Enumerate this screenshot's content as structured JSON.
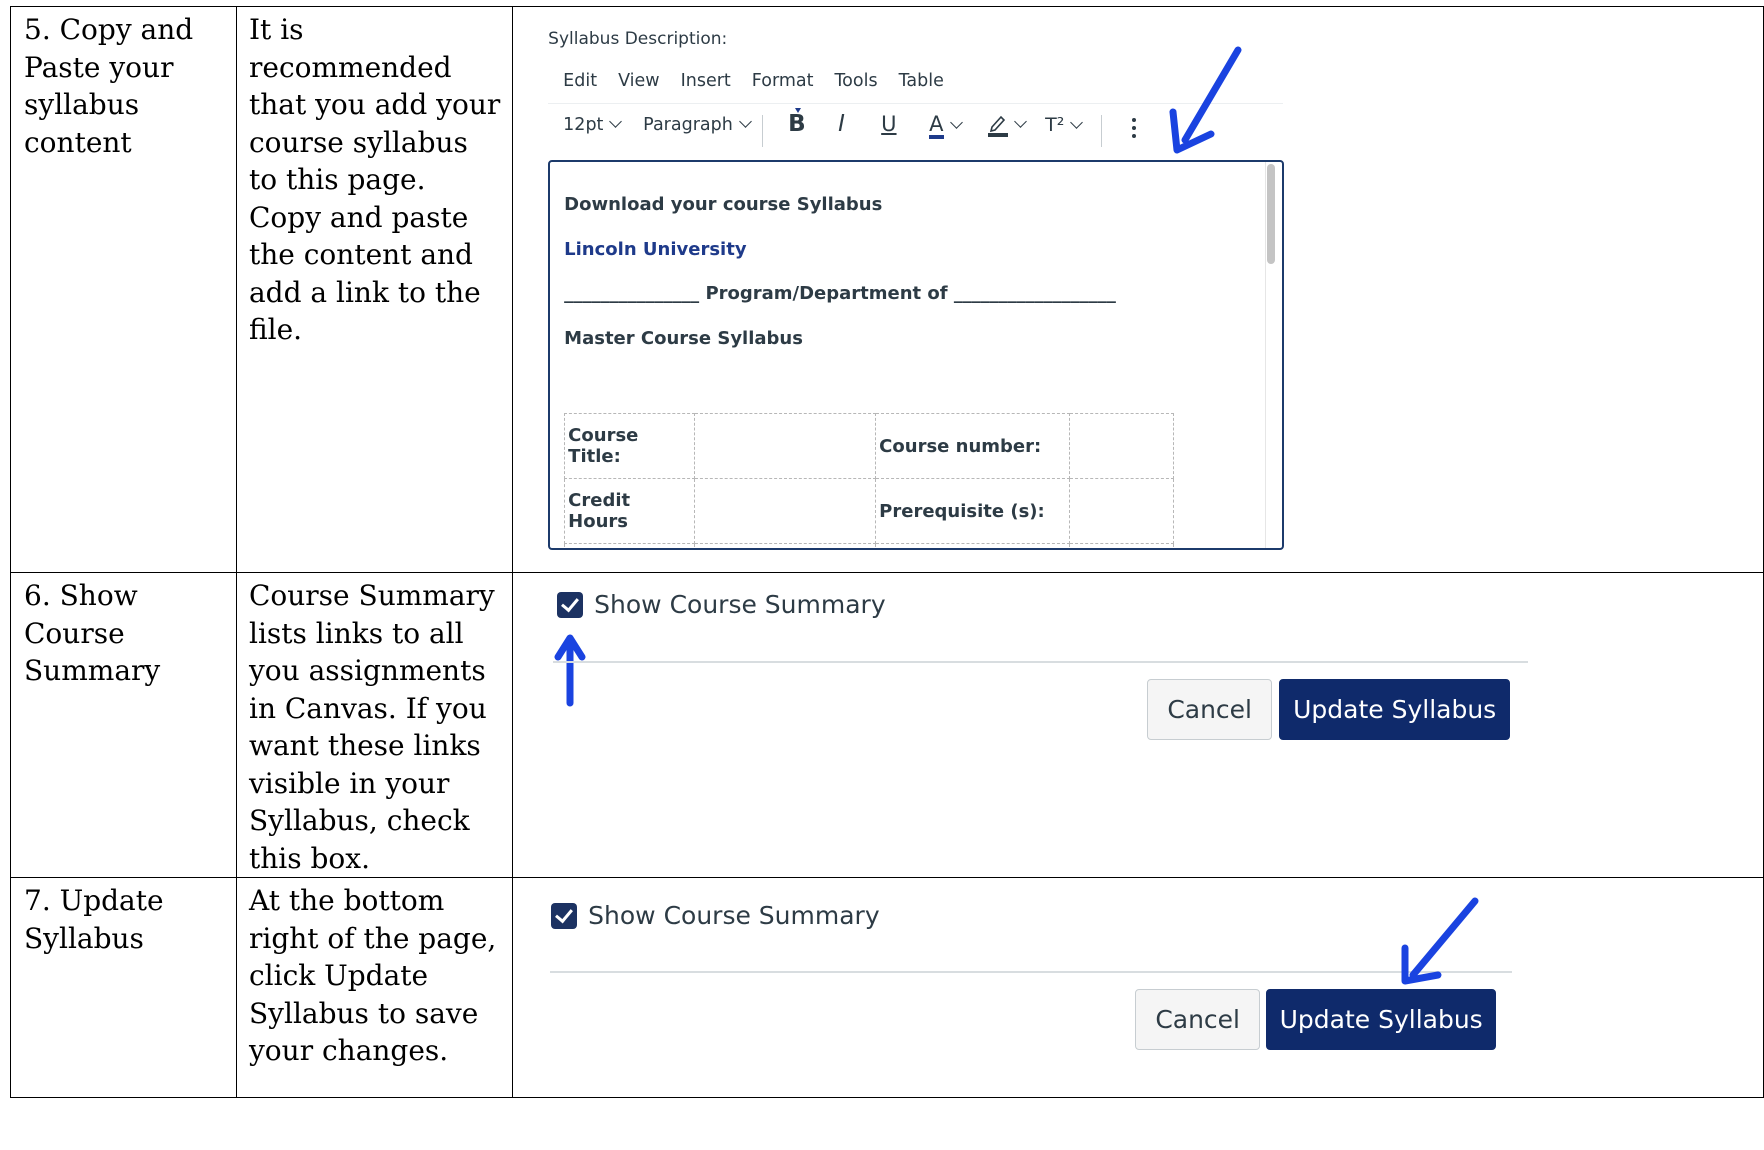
{
  "rows": [
    {
      "step": "5. Copy and Paste your syllabus content",
      "description": "It is recommended that you add your course syllabus to this page. Copy and paste the content and add a link to the file."
    },
    {
      "step": "6. Show Course Summary",
      "description": "Course Summary lists links to all you assignments in Canvas. If you want these links visible in your Syllabus, check this box."
    },
    {
      "step": "7. Update Syllabus",
      "description": "At the bottom right of the page, click Update Syllabus to save your changes."
    }
  ],
  "editor": {
    "label": "Syllabus Description:",
    "menu": [
      "Edit",
      "View",
      "Insert",
      "Format",
      "Tools",
      "Table"
    ],
    "toolbar": {
      "font_size": "12pt",
      "block_format": "Paragraph",
      "bold": "B",
      "italic": "I",
      "underline": "U",
      "text_color": "A",
      "superscript": "T²"
    },
    "content": {
      "heading": "Download your course Syllabus",
      "university": "Lincoln University",
      "department_line": "_______________ Program/Department of __________________",
      "master": "Master Course Syllabus",
      "table": [
        [
          "Course Title:",
          "",
          "Course number:",
          ""
        ],
        [
          "Credit Hours",
          "",
          "Prerequisite (s):",
          ""
        ]
      ]
    }
  },
  "summary_panel": {
    "checkbox_label": "Show Course Summary",
    "checked": true,
    "cancel_label": "Cancel",
    "update_label": "Update Syllabus"
  },
  "colors": {
    "accent_navy": "#0f2a6b",
    "arrow_blue": "#1a43e0",
    "text": "#2d3b45"
  }
}
